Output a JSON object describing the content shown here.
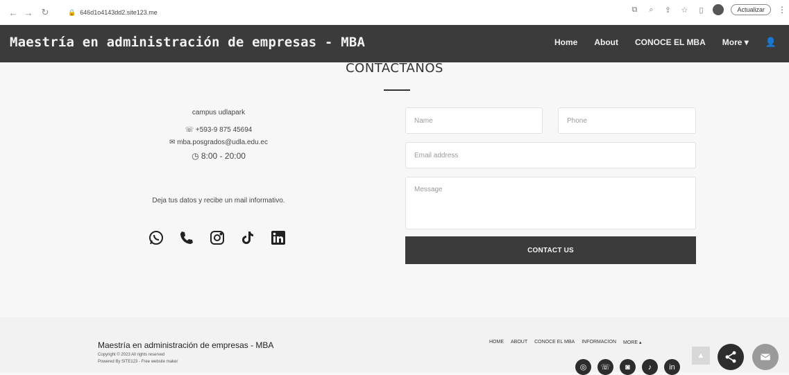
{
  "browser": {
    "url": "646d1o4143dd2.site123.me",
    "update_label": "Actualizar"
  },
  "header": {
    "site_title": "Maestría en administración de empresas - MBA",
    "nav": [
      "Home",
      "About",
      "CONOCE EL MBA",
      "More ▾"
    ]
  },
  "contact": {
    "title": "CONTACTANOS",
    "campus": "campus udlapark",
    "phone": "+593-9 875 45694",
    "email": "mba.posgrados@udla.edu.ec",
    "hours": "8:00 - 20:00",
    "cta": "Deja tus datos y recibe un mail informativo.",
    "form": {
      "name_placeholder": "Name",
      "phone_placeholder": "Phone",
      "email_placeholder": "Email address",
      "message_placeholder": "Message",
      "submit_label": "CONTACT US"
    },
    "socials": [
      "whatsapp-icon",
      "phone-icon",
      "instagram-icon",
      "tiktok-icon",
      "linkedin-icon"
    ]
  },
  "footer": {
    "title": "Maestría en administración de empresas - MBA",
    "copyright": "Copyright © 2023 All rights reserved",
    "powered": "Powered By SITE123 - Free website maker",
    "nav": [
      "HOME",
      "ABOUT",
      "CONOCE EL MBA",
      "INFORMACION",
      "MORE ▴"
    ]
  },
  "colors": {
    "header_bg": "#3b3b3b",
    "button_bg": "#3b3b3b",
    "page_bg": "#f7f7f7"
  }
}
